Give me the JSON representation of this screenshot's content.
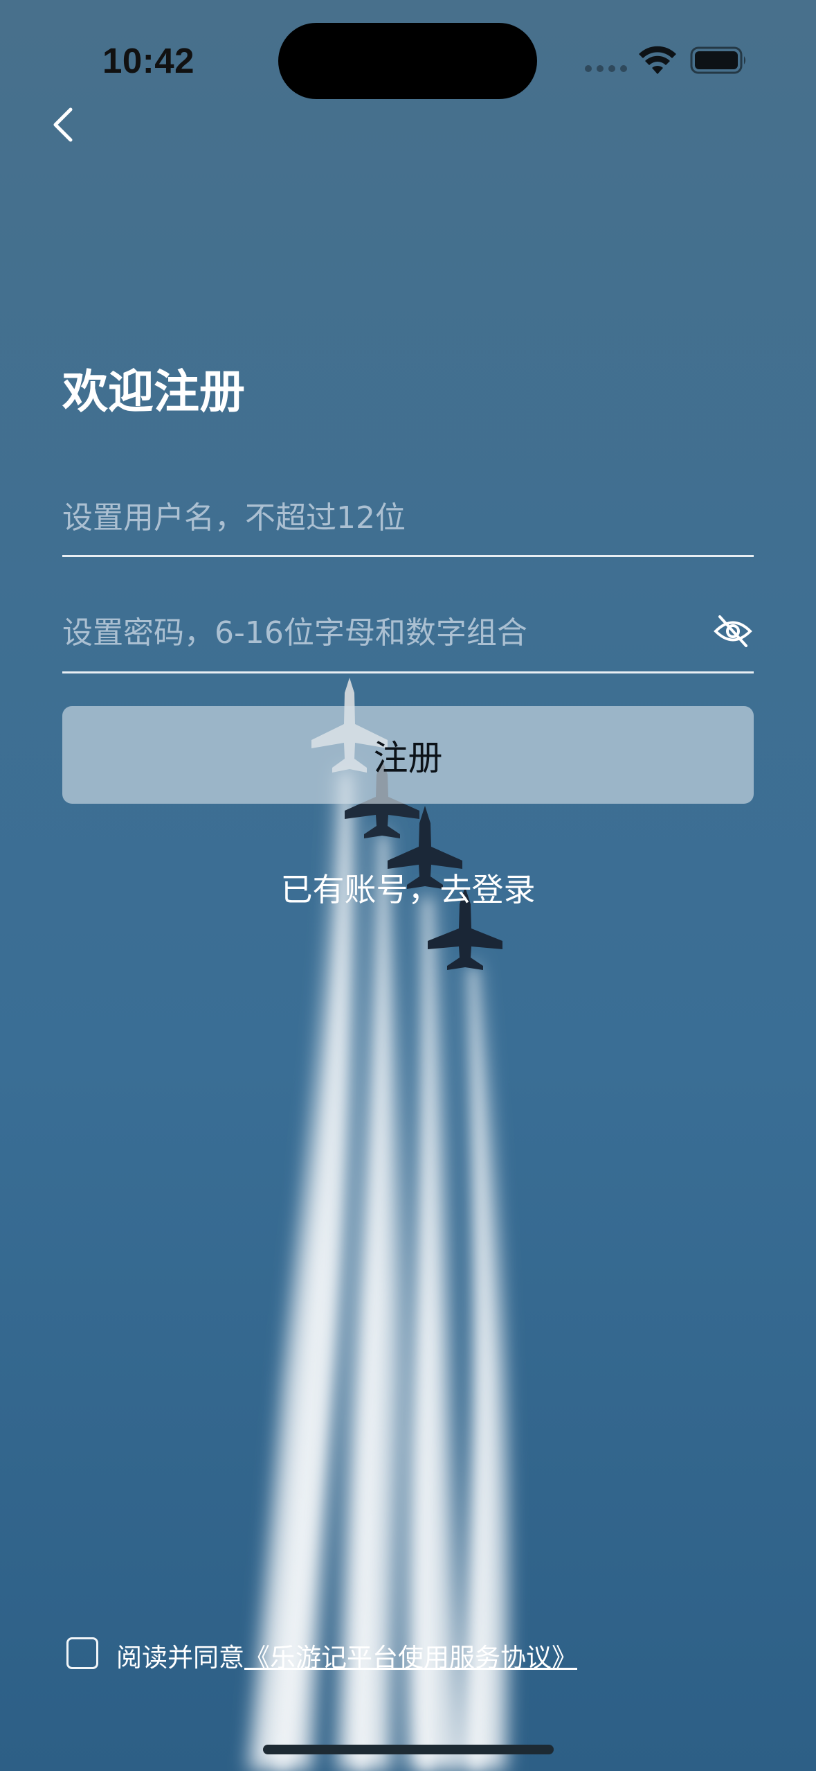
{
  "status_bar": {
    "time": "10:42"
  },
  "navigation": {
    "back_icon": "chevron-left-icon"
  },
  "register": {
    "title": "欢迎注册",
    "username_placeholder": "设置用户名，不超过12位",
    "username_value": "",
    "password_placeholder": "设置密码，6-16位字母和数字组合",
    "password_value": "",
    "password_visibility_icon": "eye-slash-icon",
    "submit_label": "注册",
    "login_link": "已有账号，去登录"
  },
  "agreement": {
    "checked": false,
    "prefix": "阅读并同意",
    "link_text": "《乐游记平台使用服务协议》"
  },
  "colors": {
    "background_top": "#48708c",
    "background_bottom": "#2d5f86",
    "button_fill": "#d5e0e8",
    "text_primary": "#ffffff"
  }
}
